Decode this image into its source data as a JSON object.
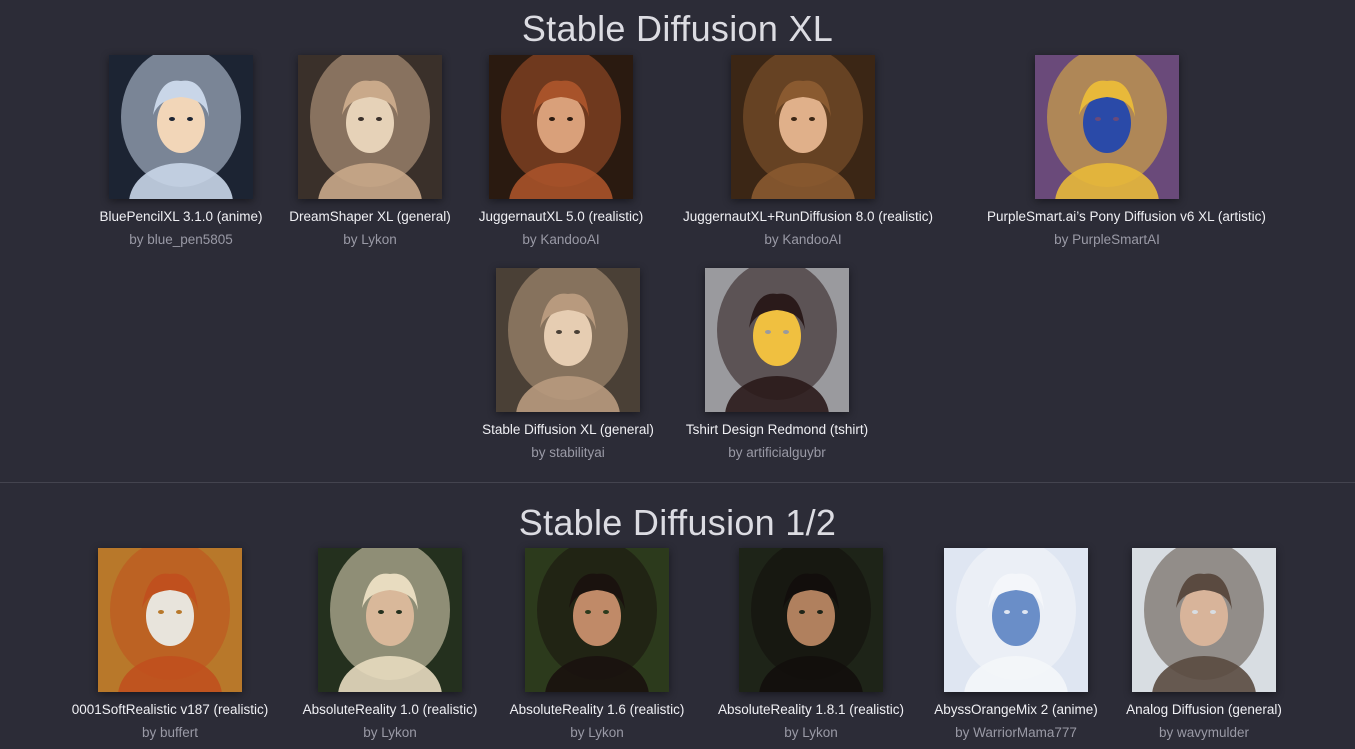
{
  "sections": [
    {
      "title": "Stable Diffusion XL",
      "models": [
        {
          "name": "BluePencilXL 3.1.0 (anime)",
          "author": "by blue_pen5805",
          "icon": "anime-girl-thumbnail",
          "colors": [
            "#1c2433",
            "#c9d6e8",
            "#f2d6b8"
          ]
        },
        {
          "name": "DreamShaper XL (general)",
          "author": "by Lykon",
          "icon": "sparkle-portrait-thumbnail",
          "colors": [
            "#3a302a",
            "#c9a98a",
            "#e6d2b8"
          ]
        },
        {
          "name": "JuggernautXL 5.0 (realistic)",
          "author": "by KandooAI",
          "icon": "redhead-portrait-thumbnail",
          "colors": [
            "#2a1a10",
            "#a8532a",
            "#d9a07a"
          ]
        },
        {
          "name": "JuggernautXL+RunDiffusion 8.0 (realistic)",
          "author": "by KandooAI",
          "icon": "forest-portrait-thumbnail",
          "colors": [
            "#3b2615",
            "#8a5a30",
            "#e0b08a"
          ]
        },
        {
          "name": "PurpleSmart.ai’s Pony Diffusion v6 XL (artistic)",
          "author": "by PurpleSmartAI",
          "icon": "pony-thumbnail",
          "colors": [
            "#6a4a7a",
            "#e8b93a",
            "#2a4aa8"
          ]
        },
        {
          "name": "Stable Diffusion XL (general)",
          "author": "by stabilityai",
          "icon": "lightning-portrait-thumbnail",
          "colors": [
            "#4a4036",
            "#b89a7e",
            "#e6cdb2"
          ]
        },
        {
          "name": "Tshirt Design Redmond (tshirt)",
          "author": "by artificialguybr",
          "icon": "headphones-girl-thumbnail",
          "colors": [
            "#9a9a9e",
            "#2a1a1a",
            "#f0c040"
          ]
        }
      ]
    },
    {
      "title": "Stable Diffusion 1/2",
      "models": [
        {
          "name": "0001SoftRealistic v187 (realistic)",
          "author": "by buffert",
          "icon": "field-redhead-thumbnail",
          "colors": [
            "#b8782a",
            "#c0501e",
            "#e8e4dc"
          ]
        },
        {
          "name": "AbsoluteReality 1.0 (realistic)",
          "author": "by Lykon",
          "icon": "blonde-portrait-thumbnail",
          "colors": [
            "#24301e",
            "#e8dcc0",
            "#d9b89a"
          ]
        },
        {
          "name": "AbsoluteReality 1.6 (realistic)",
          "author": "by Lykon",
          "icon": "forest-brunette-thumbnail",
          "colors": [
            "#2c3a1c",
            "#1a120e",
            "#c08a68"
          ]
        },
        {
          "name": "AbsoluteReality 1.8.1 (realistic)",
          "author": "by Lykon",
          "icon": "sunlit-forest-portrait-thumbnail",
          "colors": [
            "#1e2418",
            "#120e0c",
            "#b0805e"
          ]
        },
        {
          "name": "AbyssOrangeMix 2 (anime)",
          "author": "by WarriorMama777",
          "icon": "white-hair-anime-thumbnail",
          "colors": [
            "#dfe6f2",
            "#f4f6fa",
            "#6a8ec8"
          ]
        },
        {
          "name": "Analog Diffusion (general)",
          "author": "by wavymulder",
          "icon": "fur-hat-portrait-thumbnail",
          "colors": [
            "#d8dde2",
            "#5a4a40",
            "#d8b49a"
          ]
        }
      ]
    }
  ]
}
